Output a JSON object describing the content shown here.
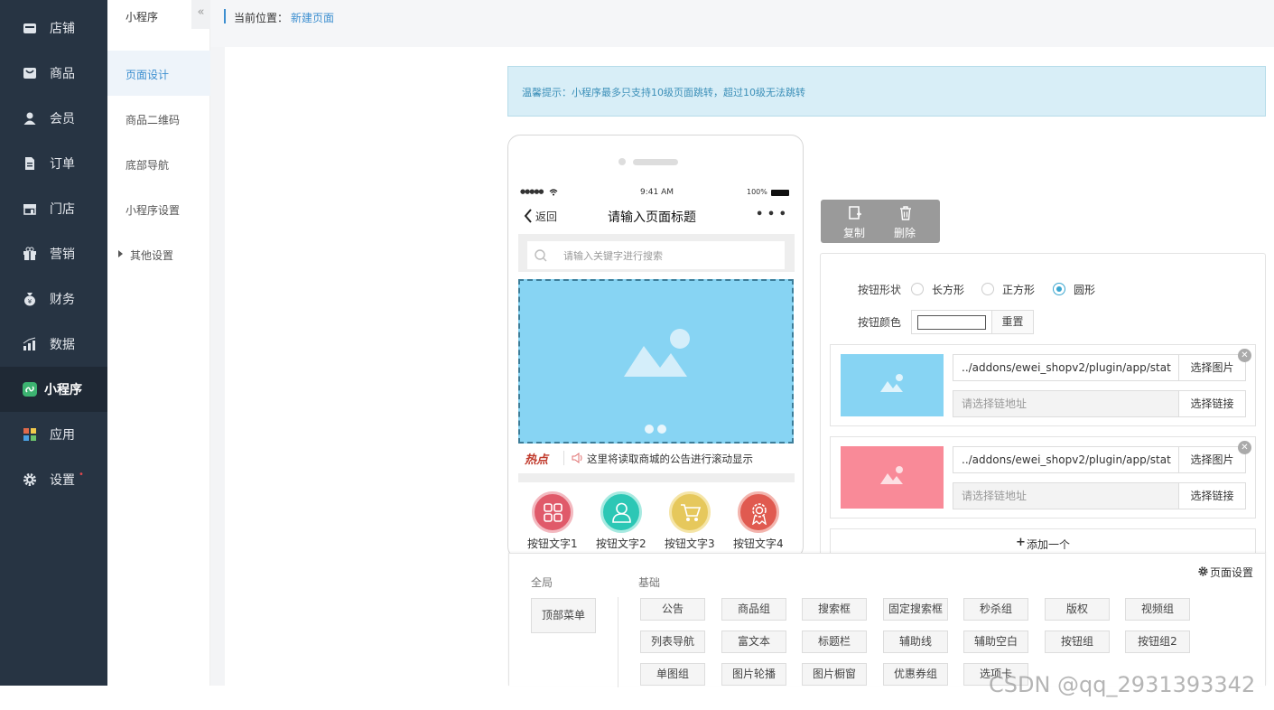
{
  "sidebar": {
    "items": [
      {
        "label": "店铺",
        "icon": "shop-icon"
      },
      {
        "label": "商品",
        "icon": "goods-icon"
      },
      {
        "label": "会员",
        "icon": "member-icon"
      },
      {
        "label": "订单",
        "icon": "order-icon"
      },
      {
        "label": "门店",
        "icon": "store-icon"
      },
      {
        "label": "营销",
        "icon": "gift-icon"
      },
      {
        "label": "财务",
        "icon": "finance-icon"
      },
      {
        "label": "数据",
        "icon": "chart-icon"
      },
      {
        "label": "小程序",
        "icon": "miniprogram-icon"
      },
      {
        "label": "应用",
        "icon": "apps-icon"
      },
      {
        "label": "设置",
        "icon": "gear-icon"
      }
    ],
    "settings_dot": "•"
  },
  "subnav": {
    "title": "小程序",
    "collapse": "«",
    "items": [
      "页面设计",
      "商品二维码",
      "底部导航",
      "小程序设置",
      "其他设置"
    ]
  },
  "breadcrumb": {
    "prefix": "当前位置：",
    "current": "新建页面"
  },
  "notice": "温馨提示：小程序最多只支持10级页面跳转，超过10级无法跳转",
  "phone": {
    "signal": "●●●●●",
    "time": "9:41 AM",
    "battery": "100%",
    "back": "返回",
    "title": "请输入页面标题",
    "menu": "• • •",
    "search_placeholder": "请输入关键字进行搜索",
    "hot_label": "热点",
    "announce": "这里将读取商城的公告进行滚动显示",
    "buttons": [
      {
        "label": "按钮文字1",
        "color": "#e05a6a"
      },
      {
        "label": "按钮文字2",
        "color": "#2cc7b5"
      },
      {
        "label": "按钮文字3",
        "color": "#e6c85c"
      },
      {
        "label": "按钮文字4",
        "color": "#e05a50"
      }
    ]
  },
  "toolbar": {
    "copy": "复制",
    "delete": "删除"
  },
  "editor": {
    "shape_label": "按钮形状",
    "shape_options": [
      "长方形",
      "正方形",
      "圆形"
    ],
    "shape_selected": "圆形",
    "color_label": "按钮颜色",
    "reset": "重置",
    "items": [
      {
        "image_path": "../addons/ewei_shopv2/plugin/app/stat",
        "link_placeholder": "请选择链地址",
        "thumb_color": "#87d4f3"
      },
      {
        "image_path": "../addons/ewei_shopv2/plugin/app/stat",
        "link_placeholder": "请选择链地址",
        "thumb_color": "#f98a98"
      }
    ],
    "select_image": "选择图片",
    "select_link": "选择链接",
    "add_one": "添加一个"
  },
  "components": {
    "global_label": "全局",
    "basic_label": "基础",
    "page_settings": "页面设置",
    "global_items": [
      "顶部菜单"
    ],
    "basic_items": [
      "公告",
      "商品组",
      "搜索框",
      "固定搜索框",
      "秒杀组",
      "版权",
      "视频组",
      "列表导航",
      "富文本",
      "标题栏",
      "辅助线",
      "辅助空白",
      "按钮组",
      "按钮组2",
      "单图组",
      "图片轮播",
      "图片橱窗",
      "优惠券组",
      "选项卡"
    ]
  },
  "watermark": "CSDN @qq_2931393342"
}
